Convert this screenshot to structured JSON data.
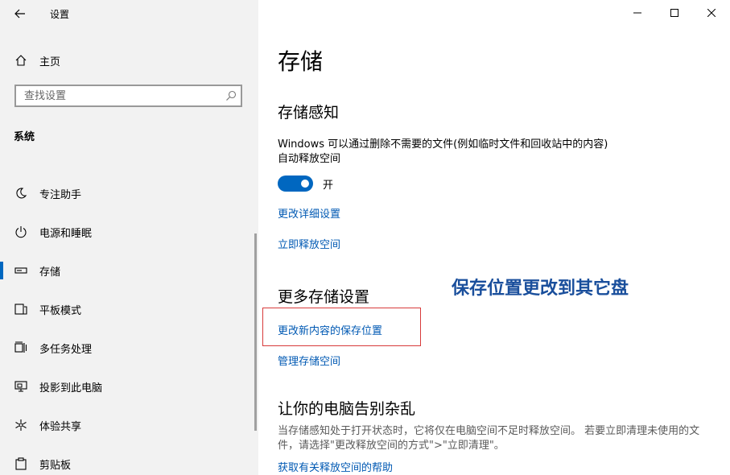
{
  "window": {
    "title": "设置"
  },
  "sidebar": {
    "home_label": "主页",
    "search_placeholder": "查找设置",
    "section_label": "系统",
    "items": [
      {
        "label": "专注助手",
        "icon": "moon-icon"
      },
      {
        "label": "电源和睡眠",
        "icon": "power-icon"
      },
      {
        "label": "存储",
        "icon": "storage-icon",
        "selected": true
      },
      {
        "label": "平板模式",
        "icon": "tablet-mode-icon"
      },
      {
        "label": "多任务处理",
        "icon": "multitasking-icon"
      },
      {
        "label": "投影到此电脑",
        "icon": "projecting-icon"
      },
      {
        "label": "体验共享",
        "icon": "shared-experiences-icon"
      },
      {
        "label": "剪贴板",
        "icon": "clipboard-icon"
      }
    ]
  },
  "main": {
    "page_title": "存储",
    "storage_sense": {
      "heading": "存储感知",
      "description_line1": "Windows 可以通过删除不需要的文件(例如临时文件和回收站中的内容)",
      "description_line2": "自动释放空间",
      "toggle_state": "开",
      "toggle_on": true,
      "link_configure": "更改详细设置",
      "link_free_now": "立即释放空间"
    },
    "more_settings": {
      "heading": "更多存储设置",
      "link_change_save_location": "更改新内容的保存位置",
      "link_manage_spaces": "管理存储空间"
    },
    "annotation": "保存位置更改到其它盘",
    "declutter": {
      "heading": "让你的电脑告别杂乱",
      "description": "当存储感知处于打开状态时，它将仅在电脑空间不足时释放空间。 若要立即清理未使用的文件，请选择\"更改释放空间的方式\">\"立即清理\"。",
      "link_help": "获取有关释放空间的帮助"
    }
  },
  "colors": {
    "accent": "#0067c0",
    "link": "#0059b3",
    "annotation": "#1a4f9c",
    "highlight_border": "#d83b3b",
    "sidebar_bg": "#f2f2f2"
  }
}
